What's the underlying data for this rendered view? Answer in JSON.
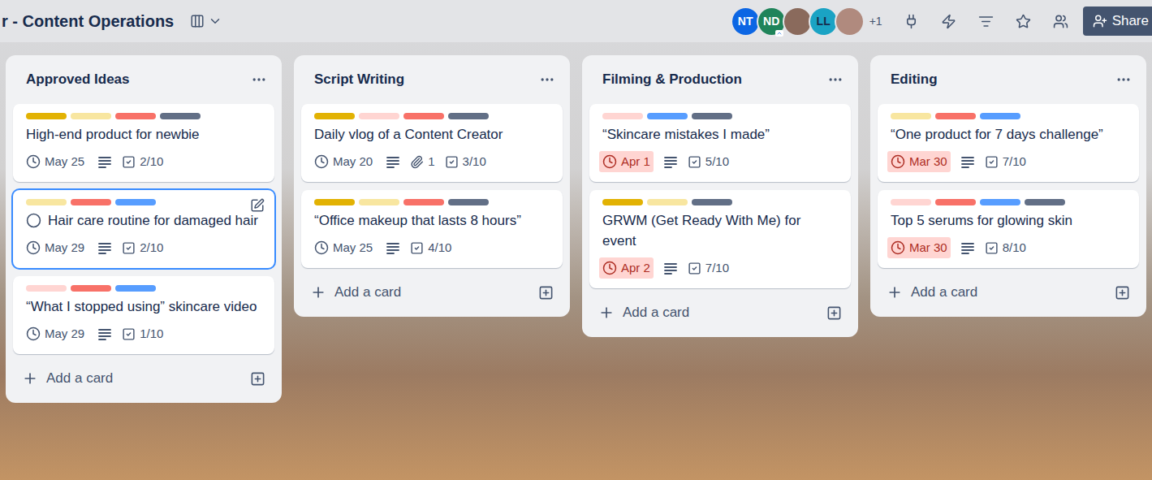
{
  "board": {
    "title": "r - Content Operations"
  },
  "members": [
    {
      "initials": "NT",
      "kind": "initials",
      "color": "#0c66e4",
      "text_color": "#ffffff",
      "admin": false
    },
    {
      "initials": "ND",
      "kind": "initials",
      "color": "#1f845a",
      "text_color": "#ffffff",
      "admin": true
    },
    {
      "initials": "",
      "kind": "photo",
      "color": "#8a6a5c",
      "text_color": "#ffffff",
      "admin": false
    },
    {
      "initials": "LL",
      "kind": "initials",
      "color": "#1aa3c4",
      "text_color": "#172b4d",
      "admin": false
    },
    {
      "initials": "",
      "kind": "photo",
      "color": "#b08a7e",
      "text_color": "#ffffff",
      "admin": false
    }
  ],
  "extra_members": "+1",
  "share_button": "Share",
  "add_card_label": "Add a card",
  "lists": [
    {
      "title": "Approved Ideas",
      "cards": [
        {
          "title": "High-end product for newbie",
          "labels": [
            {
              "color": "#e2b203"
            },
            {
              "color": "#f8e6a0"
            },
            {
              "color": "#f87168"
            },
            {
              "color": "#626f86"
            }
          ],
          "due": {
            "text": "May 25",
            "overdue": false
          },
          "description": true,
          "attachments": null,
          "checklist": "2/10",
          "selected": false
        },
        {
          "title": "Hair care routine for damaged hair",
          "labels": [
            {
              "color": "#f8e6a0"
            },
            {
              "color": "#f87168"
            },
            {
              "color": "#579dff"
            }
          ],
          "due": {
            "text": "May 29",
            "overdue": false
          },
          "description": true,
          "attachments": null,
          "checklist": "2/10",
          "selected": true
        },
        {
          "title": "“What I stopped using” skincare video",
          "labels": [
            {
              "color": "#ffd5d2"
            },
            {
              "color": "#f87168"
            },
            {
              "color": "#579dff"
            }
          ],
          "due": {
            "text": "May 29",
            "overdue": false
          },
          "description": true,
          "attachments": null,
          "checklist": "1/10",
          "selected": false
        }
      ]
    },
    {
      "title": "Script Writing",
      "cards": [
        {
          "title": "Daily vlog of a Content Creator",
          "labels": [
            {
              "color": "#e2b203"
            },
            {
              "color": "#ffd5d2"
            },
            {
              "color": "#f87168"
            },
            {
              "color": "#626f86"
            }
          ],
          "due": {
            "text": "May 20",
            "overdue": false
          },
          "description": true,
          "attachments": "1",
          "checklist": "3/10",
          "selected": false
        },
        {
          "title": "“Office makeup that lasts 8 hours”",
          "labels": [
            {
              "color": "#e2b203"
            },
            {
              "color": "#f8e6a0"
            },
            {
              "color": "#f87168"
            },
            {
              "color": "#626f86"
            }
          ],
          "due": {
            "text": "May 25",
            "overdue": false
          },
          "description": true,
          "attachments": null,
          "checklist": "4/10",
          "selected": false
        }
      ]
    },
    {
      "title": "Filming & Production",
      "cards": [
        {
          "title": "“Skincare mistakes I made”",
          "labels": [
            {
              "color": "#ffd5d2"
            },
            {
              "color": "#579dff"
            },
            {
              "color": "#626f86"
            }
          ],
          "due": {
            "text": "Apr 1",
            "overdue": true
          },
          "description": true,
          "attachments": null,
          "checklist": "5/10",
          "selected": false
        },
        {
          "title": "GRWM (Get Ready With Me) for event",
          "labels": [
            {
              "color": "#e2b203"
            },
            {
              "color": "#f8e6a0"
            },
            {
              "color": "#626f86"
            }
          ],
          "due": {
            "text": "Apr 2",
            "overdue": true
          },
          "description": true,
          "attachments": null,
          "checklist": "7/10",
          "selected": false
        }
      ]
    },
    {
      "title": "Editing",
      "cards": [
        {
          "title": "“One product for 7 days challenge”",
          "labels": [
            {
              "color": "#f8e6a0"
            },
            {
              "color": "#f87168"
            },
            {
              "color": "#579dff"
            }
          ],
          "due": {
            "text": "Mar 30",
            "overdue": true
          },
          "description": true,
          "attachments": null,
          "checklist": "7/10",
          "selected": false
        },
        {
          "title": "Top 5 serums for glowing skin",
          "labels": [
            {
              "color": "#ffd5d2"
            },
            {
              "color": "#f87168"
            },
            {
              "color": "#579dff"
            },
            {
              "color": "#626f86"
            }
          ],
          "due": {
            "text": "Mar 30",
            "overdue": true
          },
          "description": true,
          "attachments": null,
          "checklist": "8/10",
          "selected": false
        }
      ]
    }
  ]
}
